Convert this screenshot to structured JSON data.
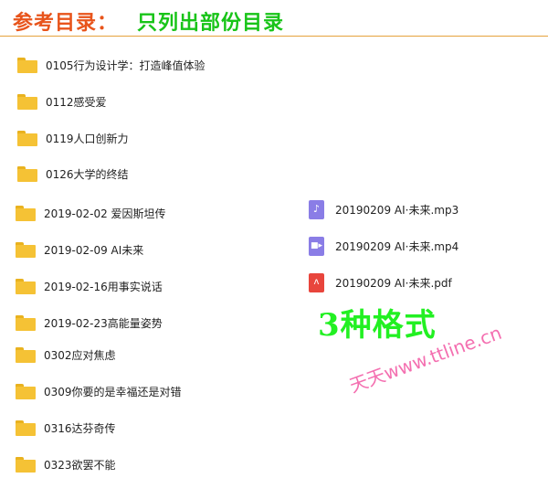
{
  "header": {
    "title": "参考目录：",
    "subtitle": "只列出部份目录"
  },
  "folders": [
    {
      "label": "0105行为设计学：打造峰值体验"
    },
    {
      "label": "0112感受爱"
    },
    {
      "label": "0119人口创新力"
    },
    {
      "label": "0126大学的终结"
    },
    {
      "label": "2019-02-02 爱因斯坦传"
    },
    {
      "label": "2019-02-09 AI未来"
    },
    {
      "label": "2019-02-16用事实说话"
    },
    {
      "label": "2019-02-23高能量姿势"
    },
    {
      "label": "0302应对焦虑"
    },
    {
      "label": "0309你要的是幸福还是对错"
    },
    {
      "label": "0316达芬奇传"
    },
    {
      "label": "0323欲罢不能"
    }
  ],
  "files": [
    {
      "label": "20190209 AI·未来.mp3",
      "icon": "audio-file-icon",
      "color": "#8a7de6"
    },
    {
      "label": "20190209 AI·未来.mp4",
      "icon": "video-file-icon",
      "color": "#8a7de6"
    },
    {
      "label": "20190209 AI·未来.pdf",
      "icon": "pdf-file-icon",
      "color": "#e8453c"
    }
  ],
  "annotation": "3种格式",
  "watermark": "天天www.ttline.cn",
  "colors": {
    "accent_orange": "#e8541b",
    "accent_green": "#18c418",
    "folder": "#f5c235"
  }
}
